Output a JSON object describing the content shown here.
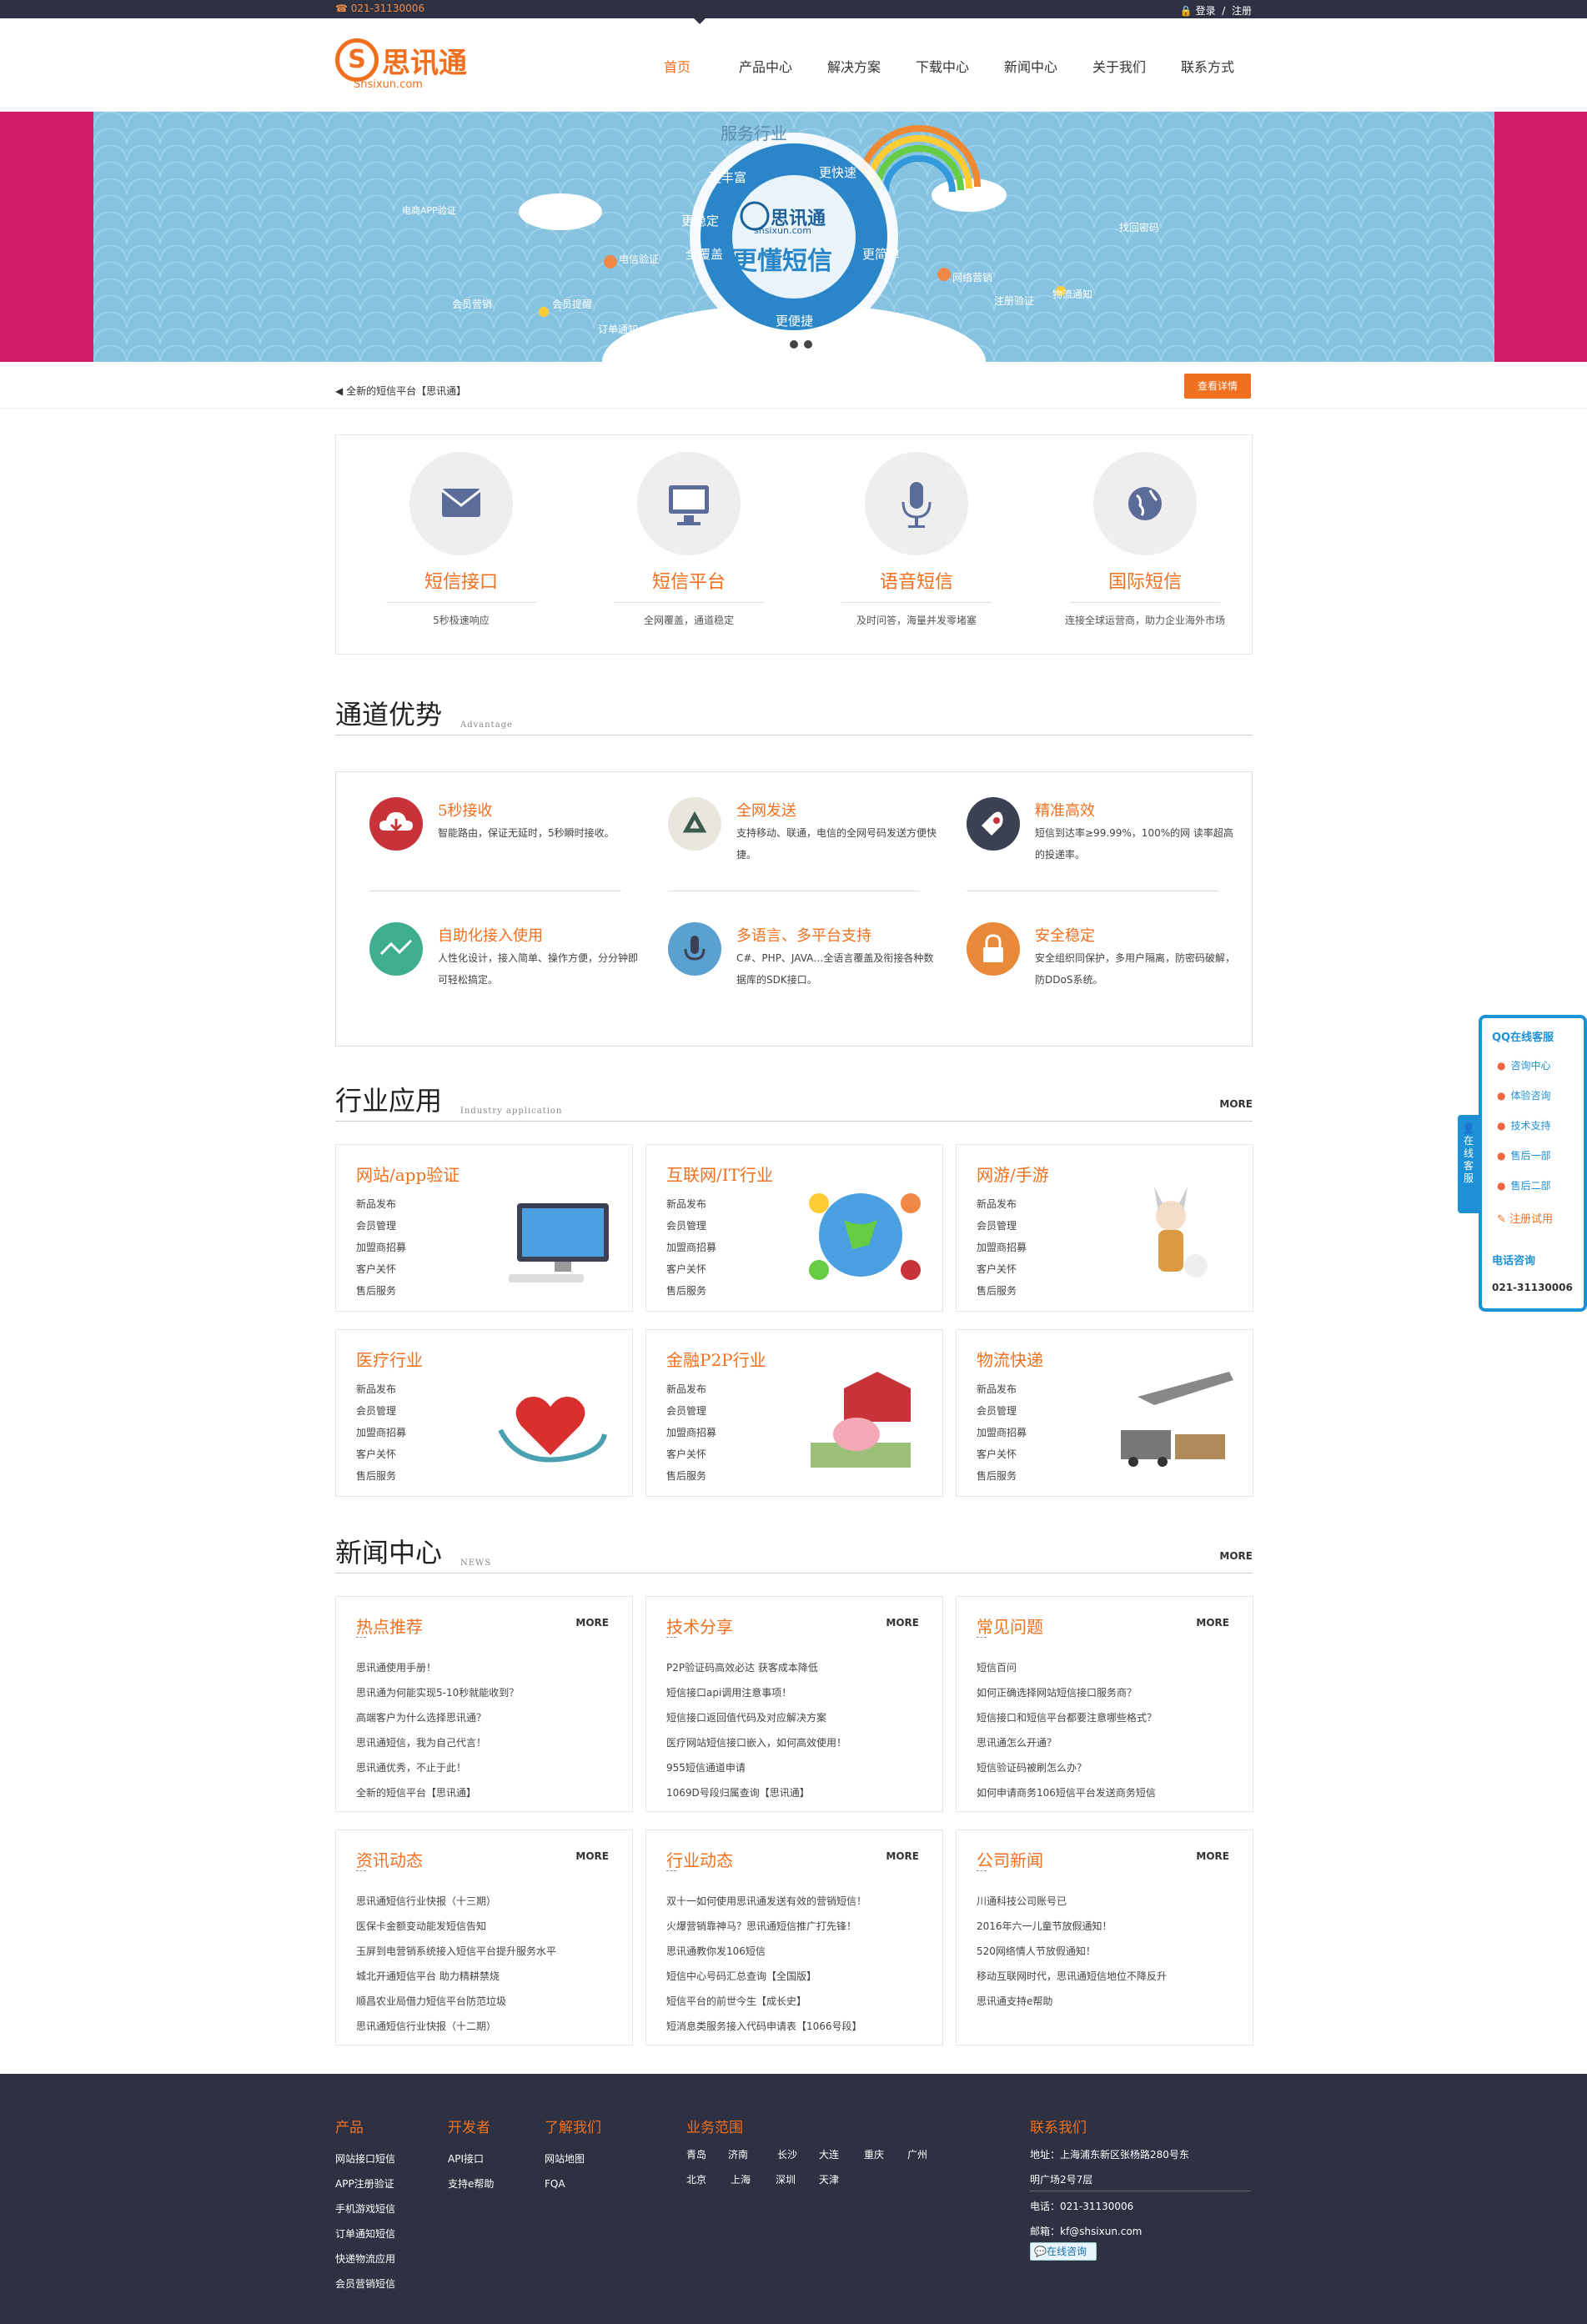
{
  "topbar": {
    "phone": "021-31130006",
    "login": "登录",
    "register": "注册"
  },
  "logo": {
    "mark": "S",
    "name": "思讯通",
    "domain": "Shsixun.com"
  },
  "nav": [
    "首页",
    "产品中心",
    "解决方案",
    "下载中心",
    "新闻中心",
    "关于我们",
    "联系方式"
  ],
  "banner": {
    "badge_top": "服务行业",
    "brand": "思讯通",
    "brand_domain": "shsixun.com",
    "slogan": "更懂短信",
    "ring": [
      "更丰富",
      "更快速",
      "更简单",
      "更便捷",
      "全覆盖",
      "更稳定"
    ],
    "tags": [
      "电信验证",
      "会员营销",
      "订单通知",
      "会员提醒",
      "网络营销",
      "物流通知",
      "电商APP验证",
      "注册验证",
      "找回密码"
    ]
  },
  "notice": {
    "text": "全新的短信平台【思讯通】",
    "button": "查看详情"
  },
  "services": [
    {
      "title": "短信接口",
      "desc": "5秒极速响应",
      "icon": "envelope-icon"
    },
    {
      "title": "短信平台",
      "desc": "全网覆盖，通道稳定",
      "icon": "monitor-icon"
    },
    {
      "title": "语音短信",
      "desc": "及时问答，海量并发零堵塞",
      "icon": "microphone-icon"
    },
    {
      "title": "国际短信",
      "desc": "连接全球运营商，助力企业海外市场",
      "icon": "globe-icon"
    }
  ],
  "advantage": {
    "title": "通道优势",
    "en": "Advantage",
    "items": [
      {
        "title": "5秒接收",
        "desc": "智能路由，保证无延时，5秒瞬时接收。",
        "color": "#c8333a"
      },
      {
        "title": "全网发送",
        "desc": "支持移动、联通，电信的全网号码发送方便快捷。",
        "color": "#e8e6df"
      },
      {
        "title": "精准高效",
        "desc": "短信到达率≥99.99%，100%的网 读率超高的投递率。",
        "color": "#3b4152"
      },
      {
        "title": "自助化接入使用",
        "desc": "人性化设计，接入简单、操作方便，分分钟即可轻松搞定。",
        "color": "#3fae8f"
      },
      {
        "title": "多语言、多平台支持",
        "desc": "C#、PHP、JAVA…全语言覆盖及衔接各种数据库的SDK接口。",
        "color": "#5aa0d0"
      },
      {
        "title": "安全稳定",
        "desc": "安全组织同保护，多用户隔离，防密码破解，防DDoS系统。",
        "color": "#e88a3a"
      }
    ]
  },
  "industry": {
    "title": "行业应用",
    "en": "Industry application",
    "more": "MORE",
    "list": [
      "新品发布",
      "会员管理",
      "加盟商招募",
      "客户关怀",
      "售后服务"
    ],
    "cards": [
      "网站/app验证",
      "互联网/IT行业",
      "网游/手游",
      "医疗行业",
      "金融P2P行业",
      "物流快递"
    ]
  },
  "newscenter": {
    "title": "新闻中心",
    "en": "NEWS",
    "more": "MORE",
    "boxes": [
      {
        "title": "热点推荐",
        "more": "MORE",
        "items": [
          "思讯通使用手册！",
          "思讯通为何能实现5-10秒就能收到？",
          "高端客户为什么选择思讯通？",
          "思讯通短信，我为自己代言！",
          "思讯通优秀，不止于此！",
          "全新的短信平台【思讯通】"
        ]
      },
      {
        "title": "技术分享",
        "more": "MORE",
        "items": [
          "P2P验证码高效必达 获客成本降低",
          "短信接口api调用注意事项！",
          "短信接口返回值代码及对应解决方案",
          "医疗网站短信接口嵌入，如何高效使用！",
          "955短信通道申请",
          "1069D号段归属查询【思讯通】"
        ]
      },
      {
        "title": "常见问题",
        "more": "MORE",
        "items": [
          "短信百问",
          "如何正确选择网站短信接口服务商？",
          "短信接口和短信平台都要注意哪些格式？",
          "思讯通怎么开通？",
          "短信验证码被刷怎么办？",
          "如何申请商务106短信平台发送商务短信"
        ]
      },
      {
        "title": "资讯动态",
        "more": "MORE",
        "items": [
          "思讯通短信行业快报（十三期）",
          "医保卡金额变动能发短信告知",
          "玉屏到电营销系统接入短信平台提升服务水平",
          "城北开通短信平台 助力精耕禁烧",
          "顺昌农业局借力短信平台防范垃圾",
          "思讯通短信行业快报（十二期）"
        ]
      },
      {
        "title": "行业动态",
        "more": "MORE",
        "items": [
          "双十一如何使用思讯通发送有效的营销短信！",
          "火爆营销靠神马？思讯通短信推广打先锋！",
          "思讯通教你发106短信",
          "短信中心号码汇总查询【全国版】",
          "短信平台的前世今生【成长史】",
          "短消息类服务接入代码申请表【1066号段】"
        ]
      },
      {
        "title": "公司新闻",
        "more": "MORE",
        "items": [
          "川通科技公司账号已",
          "2016年六一儿童节放假通知！",
          "520网络情人节放假通知！",
          "移动互联网时代，思讯通短信地位不降反升",
          "思讯通支持e帮助"
        ]
      }
    ]
  },
  "qq": {
    "title": "QQ在线客服",
    "items": [
      "咨询中心",
      "体验咨询",
      "技术支持",
      "售后一部",
      "售后二部"
    ],
    "trial": "注册试用",
    "phone_title": "电话咨询",
    "phone": "021-31130006",
    "tab": "在线客服"
  },
  "footer": {
    "cols": [
      {
        "h": "产品",
        "items": [
          "网站接口短信",
          "APP注册验证",
          "手机游戏短信",
          "订单通知短信",
          "快递物流应用",
          "会员营销短信"
        ]
      },
      {
        "h": "开发者",
        "items": [
          "API接口",
          "支持e帮助"
        ]
      },
      {
        "h": "了解我们",
        "items": [
          "网站地图",
          "FQA"
        ]
      }
    ],
    "biz": {
      "h": "业务范围",
      "cities": [
        "青岛",
        "济南",
        "长沙",
        "大连",
        "重庆",
        "广州",
        "北京",
        "上海",
        "深圳",
        "天津"
      ]
    },
    "contact": {
      "h": "联系我们",
      "address": "地址：上海浦东新区张杨路280号东",
      "address2": "明广场2号7层",
      "phone": "电话：021-31130006",
      "email": "邮箱：kf@shsixun.com",
      "chat": "在线咨询"
    }
  }
}
